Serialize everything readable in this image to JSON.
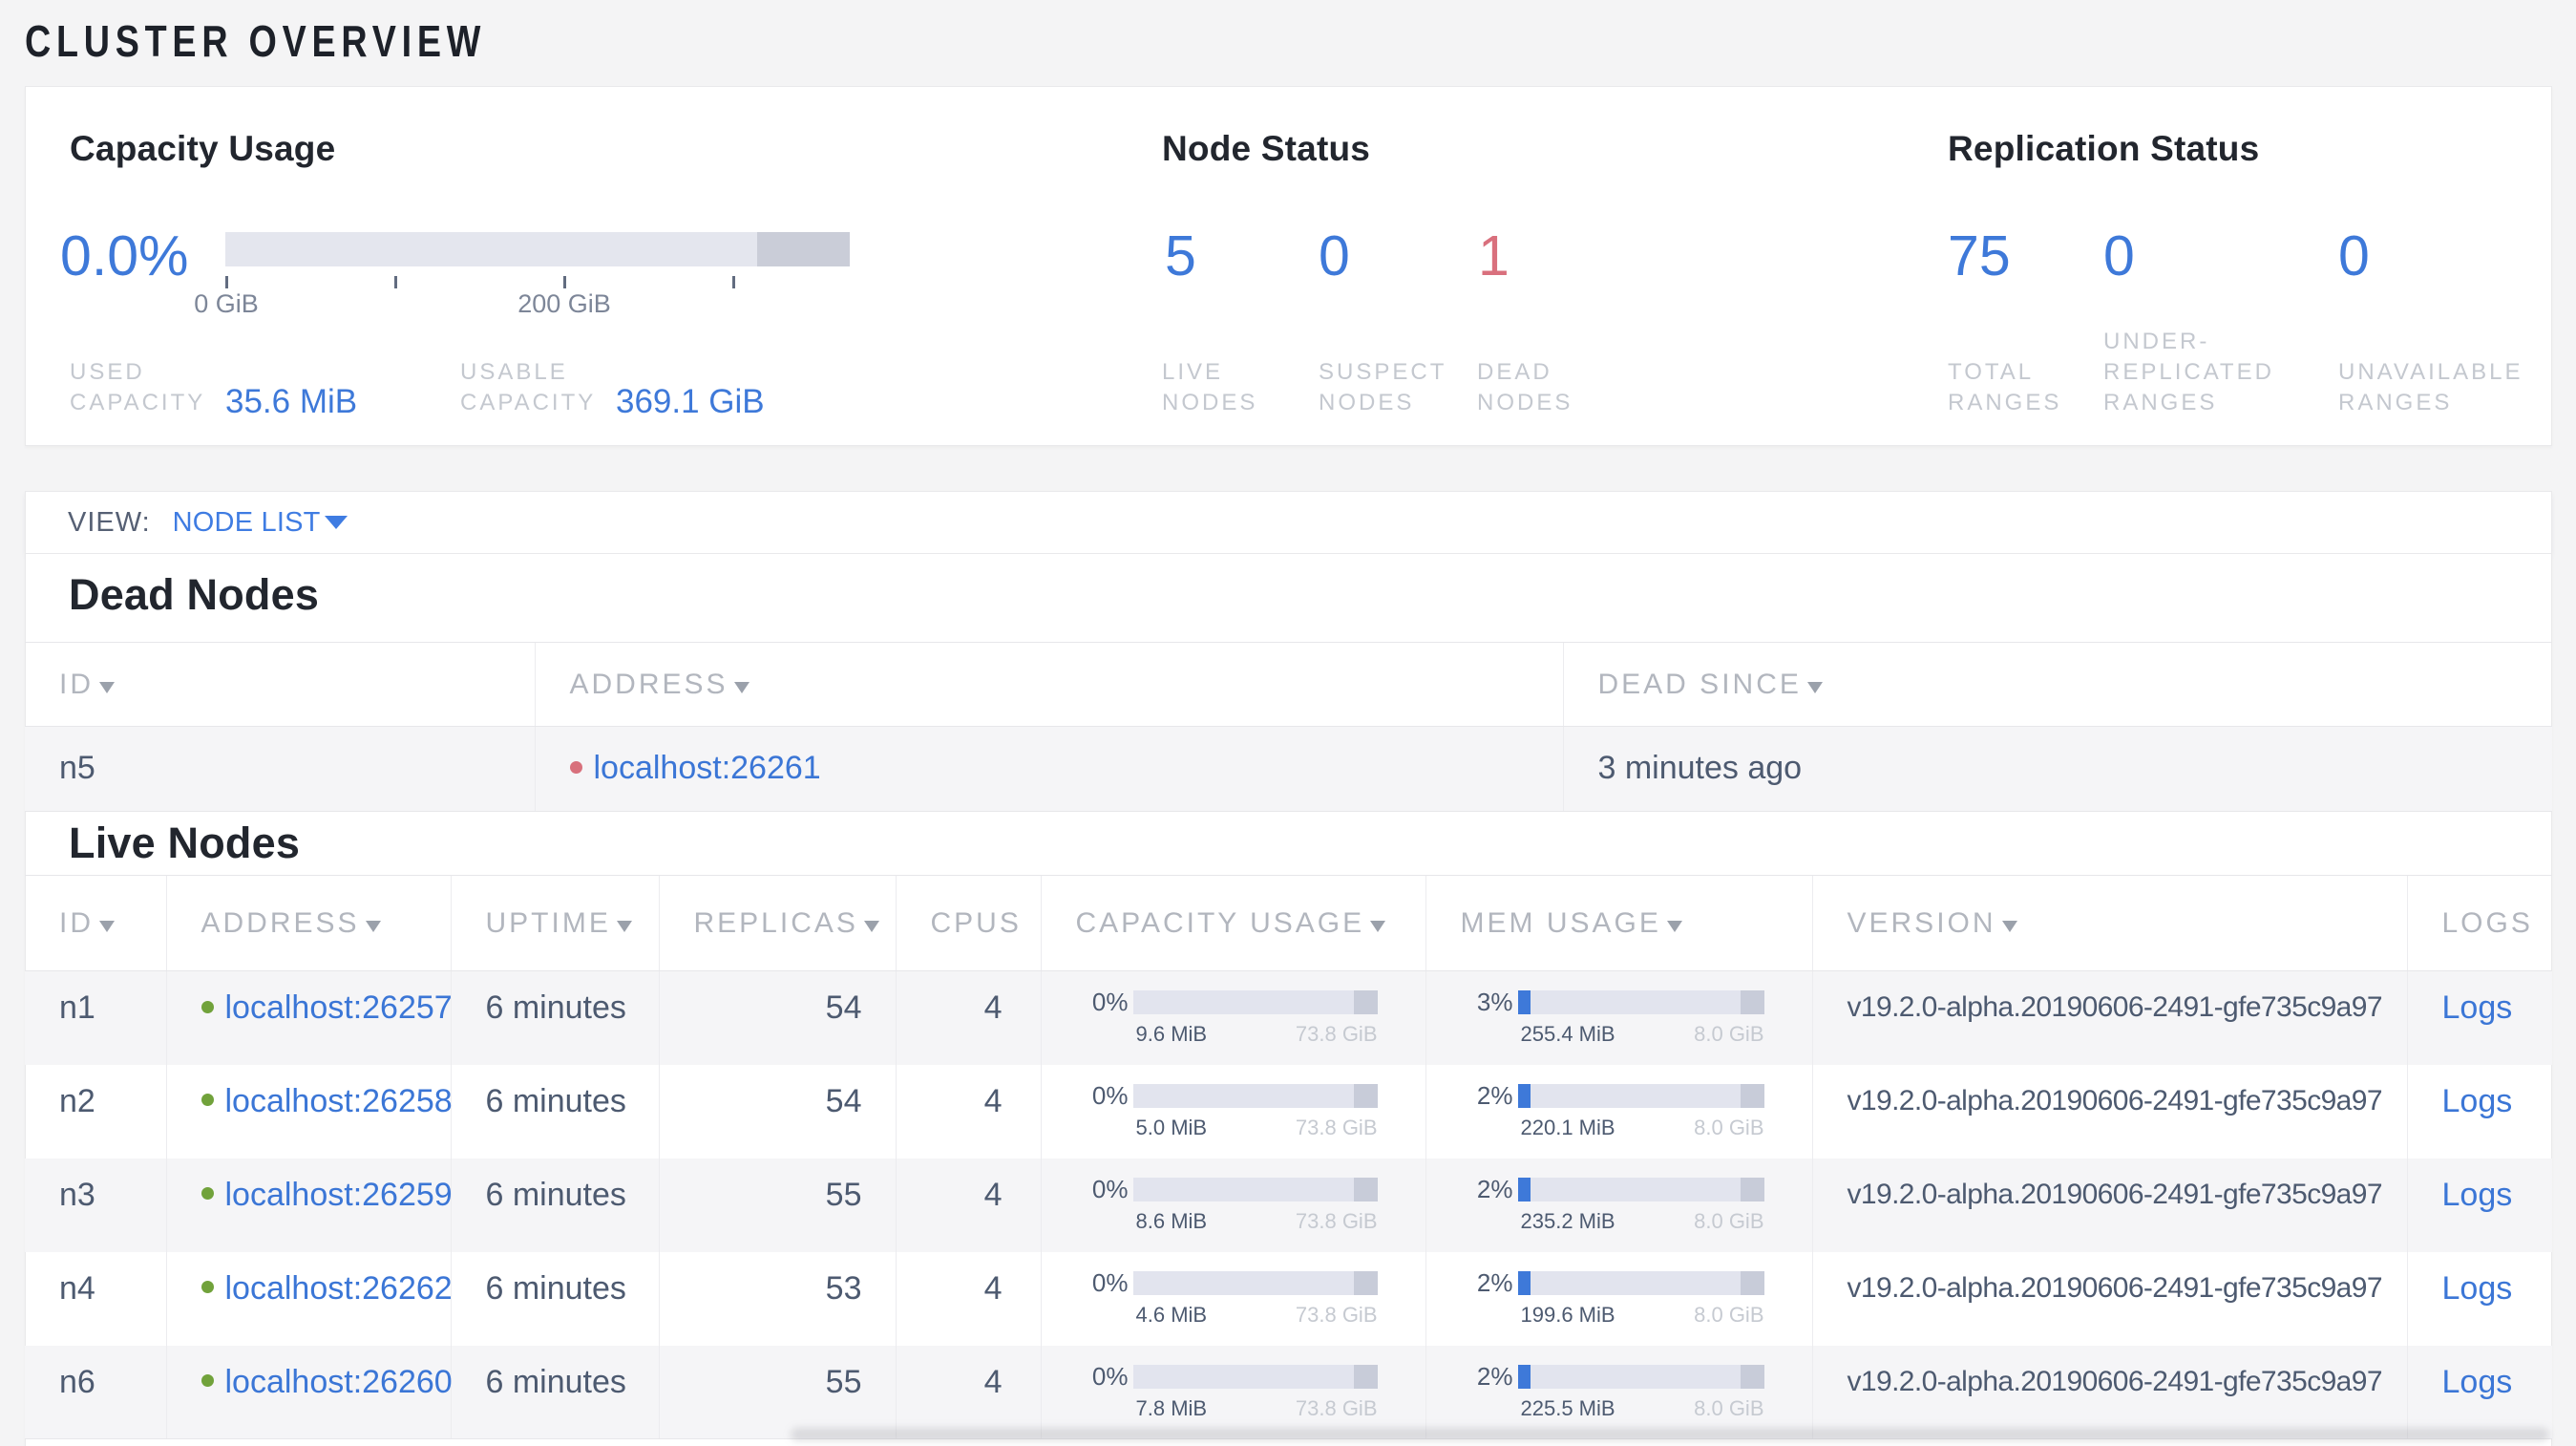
{
  "page": {
    "title": "CLUSTER OVERVIEW"
  },
  "colors": {
    "accent_blue": "#3e79d9",
    "link_blue": "#3b76d6",
    "danger_red": "#d9707d",
    "live_green": "#71a23b",
    "page_bg": "#f4f4f5"
  },
  "overview": {
    "capacity": {
      "title": "Capacity Usage",
      "percent": "0.0%",
      "used_label": "USED CAPACITY",
      "used_value": "35.6 MiB",
      "usable_label": "USABLE CAPACITY",
      "usable_value": "369.1 GiB",
      "axis_tick_0": "0 GiB",
      "axis_tick_200": "200 GiB",
      "chart": {
        "usable_gib": 369.1,
        "used_mib": 35.6,
        "axis_ticks_gib": [
          0,
          100,
          200,
          300
        ]
      }
    },
    "node_status": {
      "title": "Node Status",
      "stats": [
        {
          "value": "5",
          "label": "LIVE NODES",
          "color": "blue"
        },
        {
          "value": "0",
          "label": "SUSPECT NODES",
          "color": "blue"
        },
        {
          "value": "1",
          "label": "DEAD NODES",
          "color": "red"
        }
      ]
    },
    "replication_status": {
      "title": "Replication Status",
      "stats": [
        {
          "value": "75",
          "label": "TOTAL RANGES"
        },
        {
          "value": "0",
          "label": "UNDER-REPLICATED RANGES"
        },
        {
          "value": "0",
          "label": "UNAVAILABLE RANGES"
        }
      ]
    }
  },
  "view_bar": {
    "label": "VIEW:",
    "value": "NODE LIST"
  },
  "dead_nodes": {
    "heading": "Dead Nodes",
    "columns": {
      "id": "ID",
      "address": "ADDRESS",
      "dead_since": "DEAD SINCE"
    },
    "rows": [
      {
        "id": "n5",
        "address": "localhost:26261",
        "dead_since": "3 minutes ago"
      }
    ]
  },
  "live_nodes": {
    "heading": "Live Nodes",
    "columns": {
      "id": "ID",
      "address": "ADDRESS",
      "uptime": "UPTIME",
      "replicas": "REPLICAS",
      "cpus": "CPUS",
      "capacity_usage": "CAPACITY USAGE",
      "mem_usage": "MEM USAGE",
      "version": "VERSION",
      "logs": "LOGS"
    },
    "rows": [
      {
        "id": "n1",
        "address": "localhost:26257",
        "uptime": "6 minutes",
        "replicas": "54",
        "cpus": "4",
        "cap_pct": "0%",
        "cap_used": "9.6 MiB",
        "cap_total": "73.8 GiB",
        "mem_pct": "3%",
        "mem_used": "255.4 MiB",
        "mem_total": "8.0 GiB",
        "version": "v19.2.0-alpha.20190606-2491-gfe735c9a97",
        "logs": "Logs"
      },
      {
        "id": "n2",
        "address": "localhost:26258",
        "uptime": "6 minutes",
        "replicas": "54",
        "cpus": "4",
        "cap_pct": "0%",
        "cap_used": "5.0 MiB",
        "cap_total": "73.8 GiB",
        "mem_pct": "2%",
        "mem_used": "220.1 MiB",
        "mem_total": "8.0 GiB",
        "version": "v19.2.0-alpha.20190606-2491-gfe735c9a97",
        "logs": "Logs"
      },
      {
        "id": "n3",
        "address": "localhost:26259",
        "uptime": "6 minutes",
        "replicas": "55",
        "cpus": "4",
        "cap_pct": "0%",
        "cap_used": "8.6 MiB",
        "cap_total": "73.8 GiB",
        "mem_pct": "2%",
        "mem_used": "235.2 MiB",
        "mem_total": "8.0 GiB",
        "version": "v19.2.0-alpha.20190606-2491-gfe735c9a97",
        "logs": "Logs"
      },
      {
        "id": "n4",
        "address": "localhost:26262",
        "uptime": "6 minutes",
        "replicas": "53",
        "cpus": "4",
        "cap_pct": "0%",
        "cap_used": "4.6 MiB",
        "cap_total": "73.8 GiB",
        "mem_pct": "2%",
        "mem_used": "199.6 MiB",
        "mem_total": "8.0 GiB",
        "version": "v19.2.0-alpha.20190606-2491-gfe735c9a97",
        "logs": "Logs"
      },
      {
        "id": "n6",
        "address": "localhost:26260",
        "uptime": "6 minutes",
        "replicas": "55",
        "cpus": "4",
        "cap_pct": "0%",
        "cap_used": "7.8 MiB",
        "cap_total": "73.8 GiB",
        "mem_pct": "2%",
        "mem_used": "225.5 MiB",
        "mem_total": "8.0 GiB",
        "version": "v19.2.0-alpha.20190606-2491-gfe735c9a97",
        "logs": "Logs"
      }
    ]
  }
}
